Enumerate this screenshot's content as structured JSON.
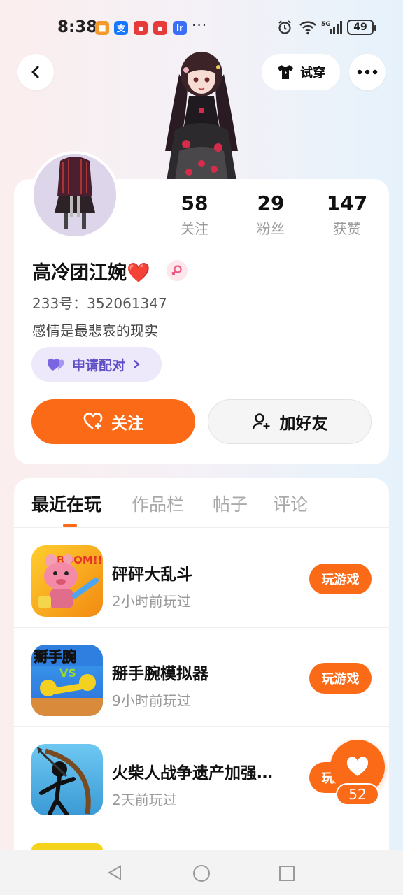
{
  "status_bar": {
    "time": "8:38",
    "battery": "49",
    "network": "5G"
  },
  "header": {
    "tryon_label": "试穿"
  },
  "profile": {
    "stats": [
      {
        "value": "58",
        "label": "关注"
      },
      {
        "value": "29",
        "label": "粉丝"
      },
      {
        "value": "147",
        "label": "获赞"
      }
    ],
    "username": "高冷团江婉❤️",
    "uid": "233号：352061347",
    "bio": "感情是最悲哀的现实",
    "pair_label": "申请配对",
    "follow_label": "关注",
    "add_friend_label": "加好友"
  },
  "tabs": [
    {
      "label": "最近在玩"
    },
    {
      "label": "作品栏"
    },
    {
      "label": "帖子"
    },
    {
      "label": "评论"
    }
  ],
  "games": [
    {
      "title": "砰砰大乱斗",
      "subtitle": "2小时前玩过",
      "button": "玩游戏",
      "thumb_text": "BOOM!!"
    },
    {
      "title": "掰手腕模拟器",
      "subtitle": "9小时前玩过",
      "button": "玩游戏",
      "thumb_text": "掰手腕"
    },
    {
      "title": "火柴人战争遗产加强…",
      "subtitle": "2天前玩过",
      "button": "玩游戏",
      "thumb_text": ""
    }
  ],
  "fab": {
    "count": "52"
  },
  "colors": {
    "accent": "#fa6a17",
    "pair": "#5f4fc7"
  }
}
